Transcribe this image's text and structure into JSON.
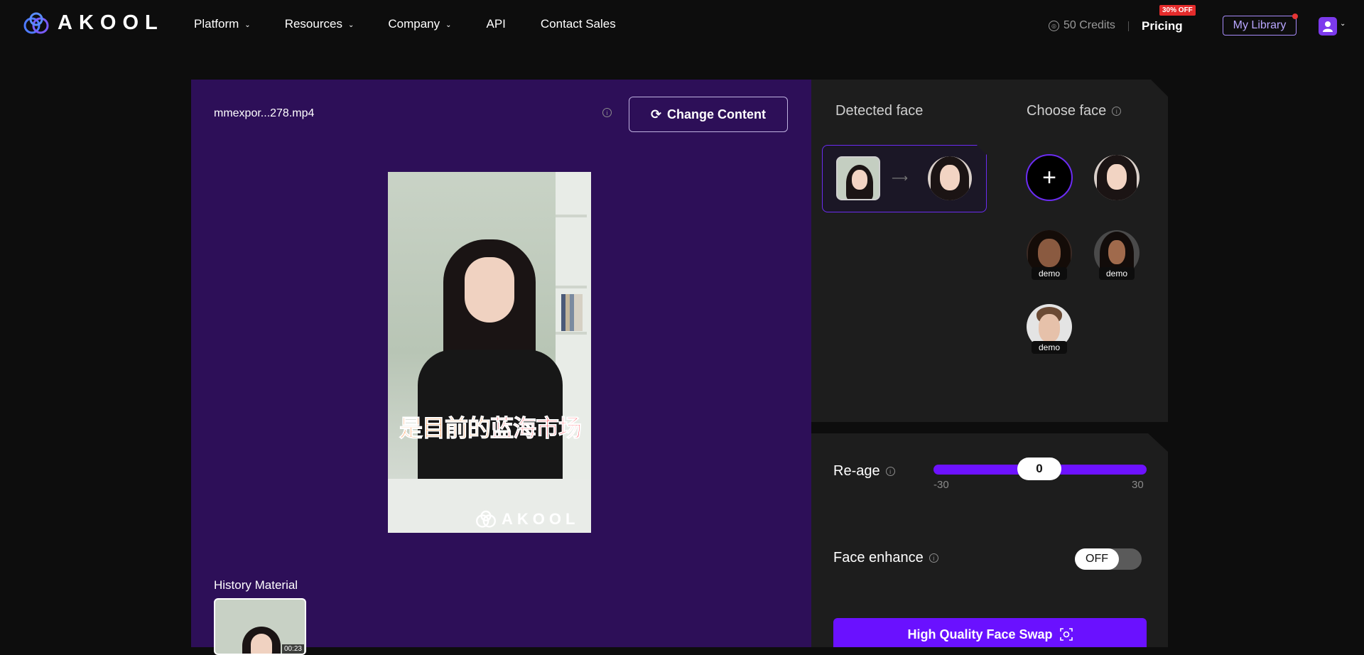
{
  "brand": {
    "name": "AKOOL"
  },
  "nav": {
    "items": [
      {
        "label": "Platform",
        "has_dropdown": true
      },
      {
        "label": "Resources",
        "has_dropdown": true
      },
      {
        "label": "Company",
        "has_dropdown": true
      },
      {
        "label": "API",
        "has_dropdown": false
      },
      {
        "label": "Contact Sales",
        "has_dropdown": false
      }
    ],
    "credits": "50 Credits",
    "pricing": "Pricing",
    "discount_badge": "30% OFF",
    "my_library": "My Library"
  },
  "editor": {
    "file_name": "mmexpor...278.mp4",
    "change_content": "Change Content",
    "subtitle_orange": "是目前的",
    "subtitle_red": "蓝海市场",
    "watermark": "AKOOL",
    "history_label": "History Material",
    "history_items": [
      {
        "duration": "00:23"
      }
    ]
  },
  "faces": {
    "detected_label": "Detected face",
    "choose_label": "Choose face",
    "add_symbol": "+",
    "options": [
      {
        "tag": ""
      },
      {
        "tag": "demo"
      },
      {
        "tag": "demo"
      },
      {
        "tag": "demo"
      }
    ]
  },
  "settings": {
    "reage_label": "Re-age",
    "reage_value": "0",
    "reage_min": "-30",
    "reage_max": "30",
    "enhance_label": "Face enhance",
    "enhance_state": "OFF",
    "submit_label": "High Quality Face Swap"
  },
  "colors": {
    "accent": "#6a11ff",
    "left_panel_bg": "#2d0f58",
    "right_panel_bg": "#1d1d1d",
    "badge_red": "#e52c2c"
  }
}
